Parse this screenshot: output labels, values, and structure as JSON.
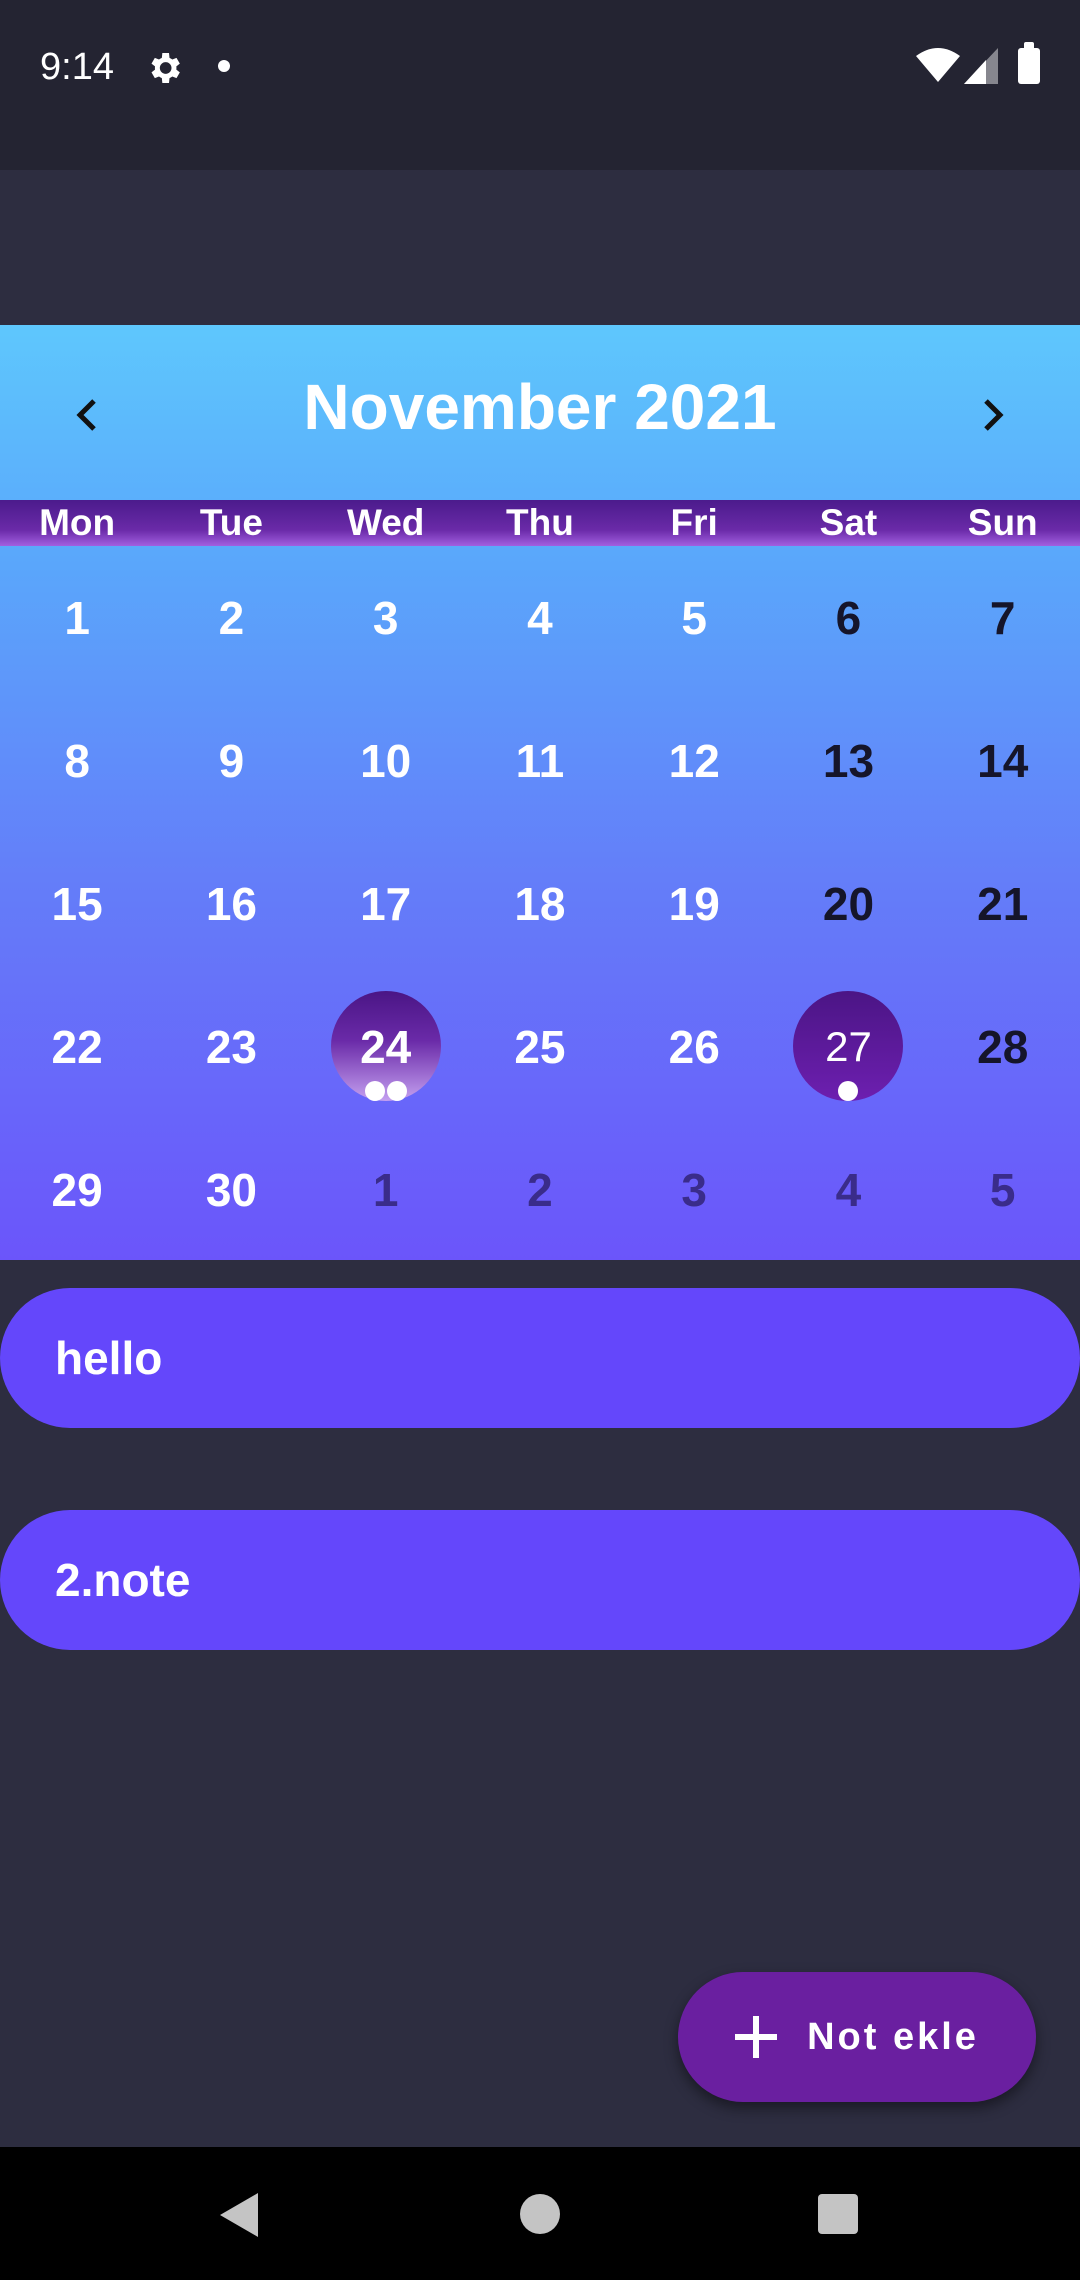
{
  "status_bar": {
    "time": "9:14",
    "icons": [
      "gear-icon",
      "notification-dot-icon",
      "wifi-icon",
      "signal-icon",
      "battery-icon"
    ]
  },
  "calendar": {
    "title": "November 2021",
    "prev_icon": "chevron-left-icon",
    "next_icon": "chevron-right-icon",
    "weekdays": [
      "Mon",
      "Tue",
      "Wed",
      "Thu",
      "Fri",
      "Sat",
      "Sun"
    ],
    "weeks": [
      [
        "1",
        "2",
        "3",
        "4",
        "5",
        "6",
        "7"
      ],
      [
        "8",
        "9",
        "10",
        "11",
        "12",
        "13",
        "14"
      ],
      [
        "15",
        "16",
        "17",
        "18",
        "19",
        "20",
        "21"
      ],
      [
        "22",
        "23",
        "24",
        "25",
        "26",
        "27",
        "28"
      ],
      [
        "29",
        "30",
        "1",
        "2",
        "3",
        "4",
        "5"
      ]
    ],
    "today": "24",
    "selected": "27",
    "events": {
      "24": 2,
      "27": 1
    },
    "colors": {
      "top": "#5ec7fd",
      "bottom": "#6b55fa",
      "weekday_bar": "#6a2aa8",
      "today_circle": "#6a2aa8",
      "selected_circle": "#6d1fb0"
    }
  },
  "notes": [
    {
      "title": "hello"
    },
    {
      "title": "2.note"
    }
  ],
  "fab": {
    "label": "Not ekle",
    "icon": "plus-icon",
    "color": "#6a1fa0"
  },
  "nav_bar": {
    "icons": [
      "back-icon",
      "home-icon",
      "recents-icon"
    ]
  }
}
